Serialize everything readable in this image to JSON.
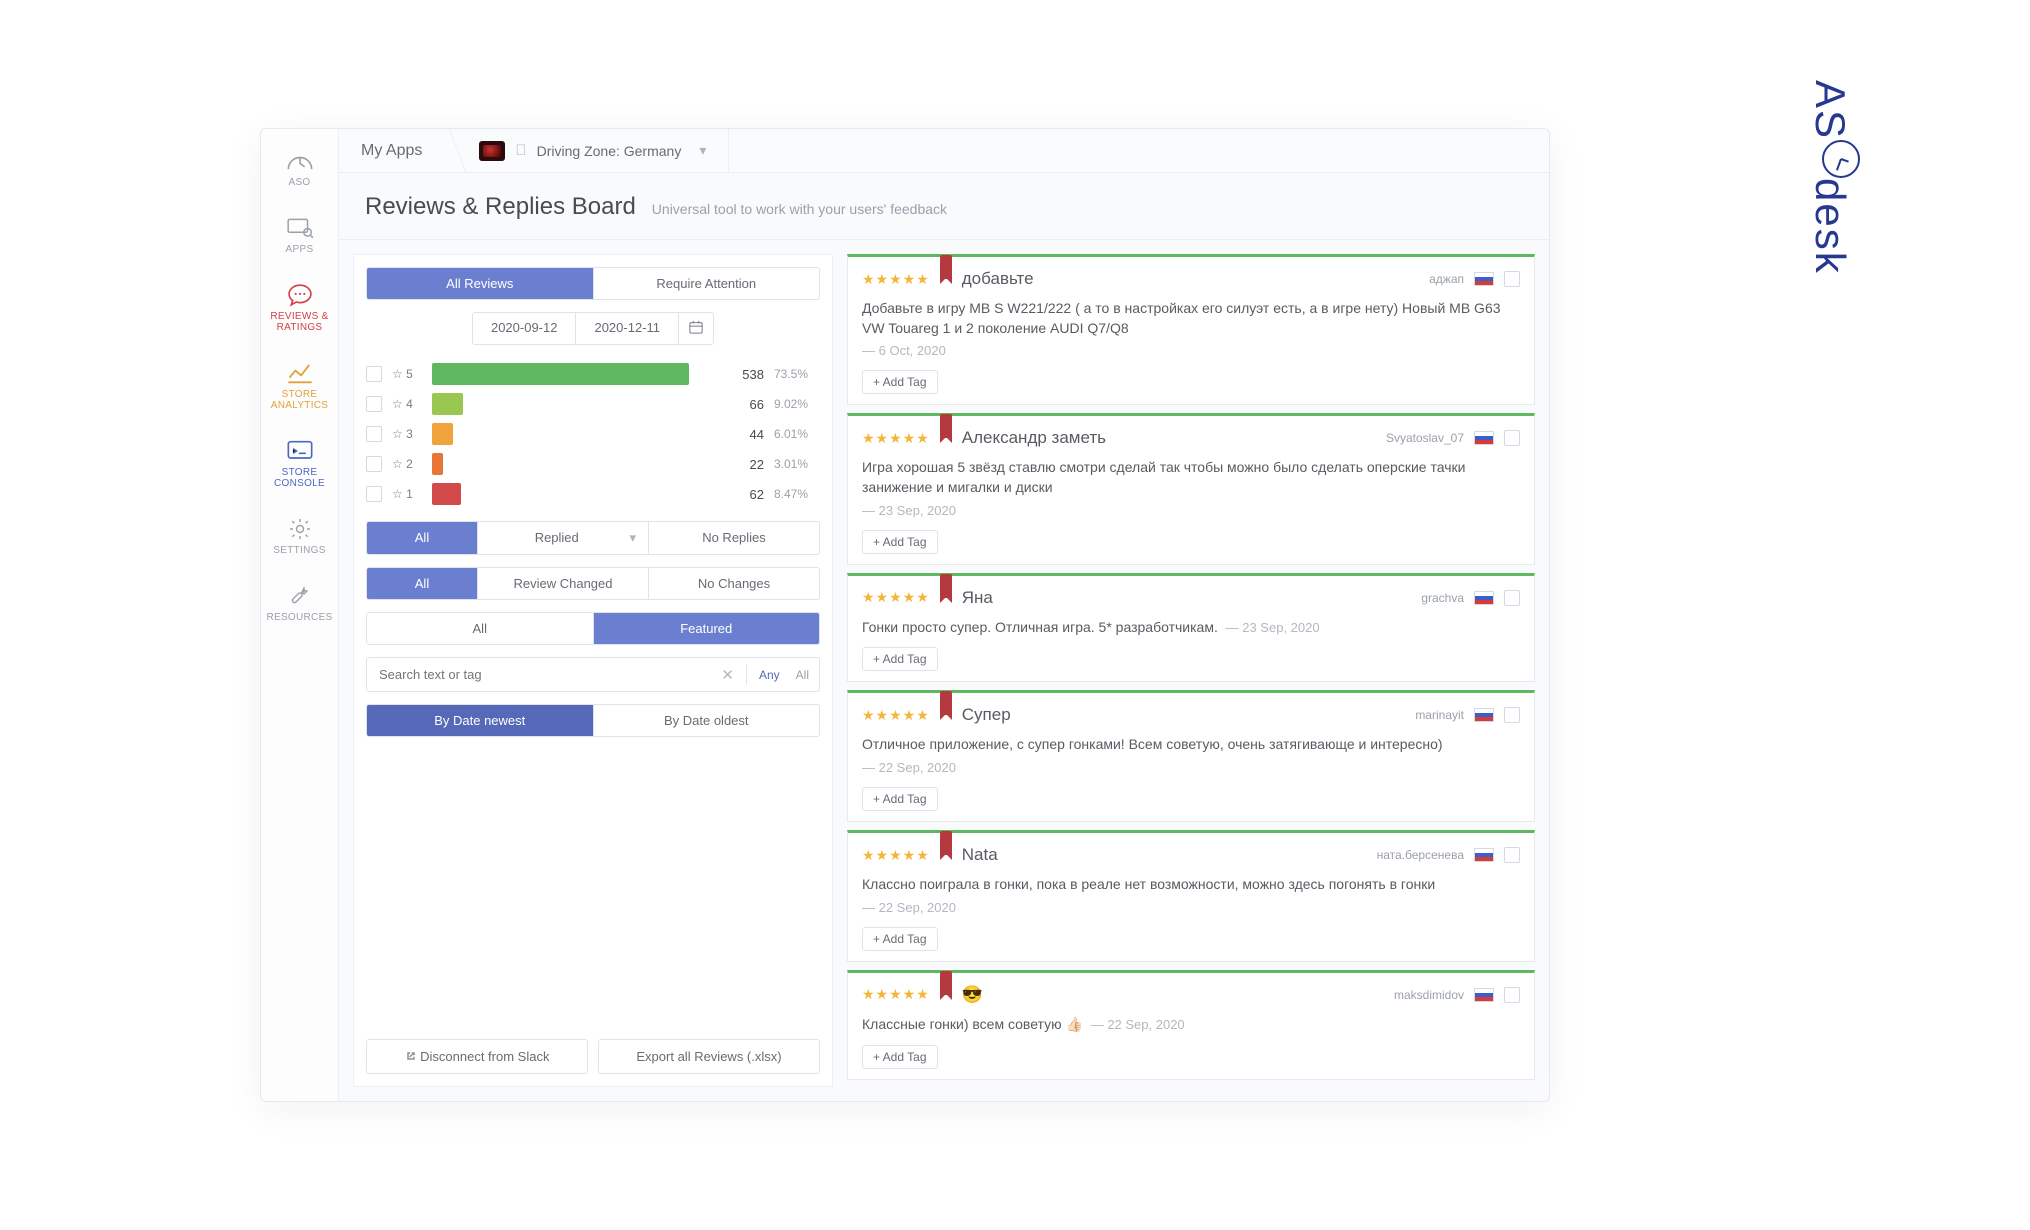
{
  "brand": "ASOdesk",
  "sidebar": {
    "items": [
      {
        "label": "ASO"
      },
      {
        "label": "APPS"
      },
      {
        "label": "REVIEWS & RATINGS"
      },
      {
        "label": "STORE ANALYTICS"
      },
      {
        "label": "STORE CONSOLE"
      },
      {
        "label": "SETTINGS"
      },
      {
        "label": "RESOURCES"
      }
    ]
  },
  "breadcrumb": {
    "apps_label": "My Apps",
    "app_name": "Driving Zone: Germany"
  },
  "heading": {
    "title": "Reviews & Replies Board",
    "subtitle": "Universal tool to work with your users' feedback"
  },
  "filters": {
    "tabs": {
      "all": "All Reviews",
      "attention": "Require Attention"
    },
    "date_from": "2020-09-12",
    "date_to": "2020-12-11",
    "reply": {
      "all": "All",
      "replied": "Replied",
      "noreplies": "No Replies"
    },
    "change": {
      "all": "All",
      "changed": "Review Changed",
      "nochange": "No Changes"
    },
    "feature": {
      "all": "All",
      "featured": "Featured"
    },
    "search_placeholder": "Search text or tag",
    "search_any": "Any",
    "search_all": "All",
    "sort_newest": "By Date newest",
    "sort_oldest": "By Date oldest",
    "disconnect": "Disconnect from Slack",
    "export": "Export all Reviews (.xlsx)"
  },
  "chart_data": {
    "type": "bar",
    "orientation": "horizontal",
    "categories": [
      "☆ 5",
      "☆ 4",
      "☆ 3",
      "☆ 2",
      "☆ 1"
    ],
    "values": [
      538,
      66,
      44,
      22,
      62
    ],
    "percentages": [
      "73.5%",
      "9.02%",
      "6.01%",
      "3.01%",
      "8.47%"
    ],
    "colors": [
      "#5fb760",
      "#9ac752",
      "#f0a33a",
      "#e77538",
      "#d24a49"
    ],
    "xlim": [
      0,
      600
    ]
  },
  "reviews": [
    {
      "title": "добавьте",
      "author": "аджап",
      "body": "Добавьте в игру MB S W221/222 ( а то в настройках его силуэт есть, а в игре нету) Новый MB G63 VW Touareg 1 и 2 поколение AUDI Q7/Q8",
      "date": "6 Oct, 2020",
      "add_tag": "+ Add Tag"
    },
    {
      "title": "Александр заметь",
      "author": "Svyatoslav_07",
      "body": "Игра хорошая 5 звёзд ставлю смотри сделай так чтобы можно было сделать оперские тачки занижение и мигалки и диски",
      "date": "23 Sep, 2020",
      "add_tag": "+ Add Tag"
    },
    {
      "title": "Яна",
      "author": "grachva",
      "body": "Гонки просто супер. Отличная игра. 5* разработчикам.",
      "date": "23 Sep, 2020",
      "add_tag": "+ Add Tag"
    },
    {
      "title": "Супер",
      "author": "marinayit",
      "body": "Отличное приложение, с супер гонками! Всем советую, очень затягивающе и интересно)",
      "date": "22 Sep, 2020",
      "add_tag": "+ Add Tag"
    },
    {
      "title": "Nata",
      "author": "ната.берсенева",
      "body": "Классно поиграла в гонки, пока в реале нет возможности, можно здесь погонять в гонки",
      "date": "22 Sep, 2020",
      "add_tag": "+ Add Tag"
    },
    {
      "title": "😎",
      "author": "maksdimidov",
      "body": "Классные гонки) всем советую 👍🏻",
      "date": "22 Sep, 2020",
      "add_tag": "+ Add Tag"
    }
  ]
}
